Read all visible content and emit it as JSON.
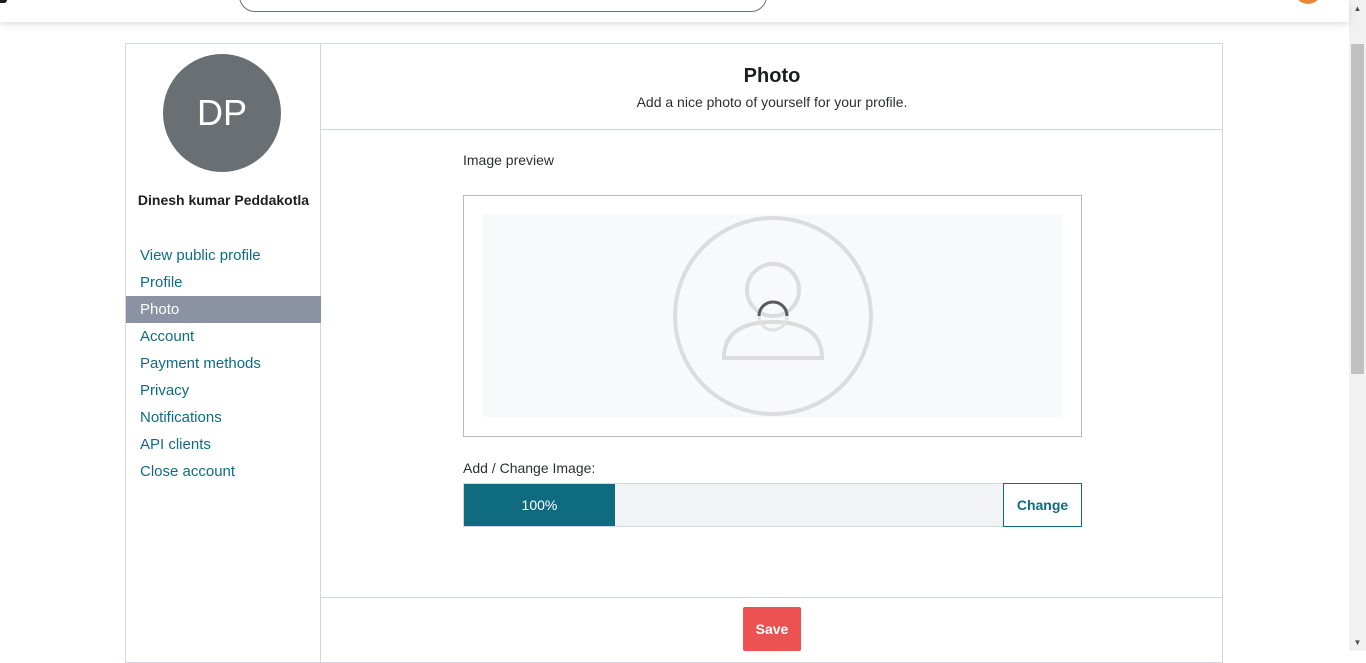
{
  "user": {
    "initials": "DP",
    "name": "Dinesh kumar Peddakotla"
  },
  "sidebar": {
    "items": [
      {
        "label": "View public profile",
        "active": false
      },
      {
        "label": "Profile",
        "active": false
      },
      {
        "label": "Photo",
        "active": true
      },
      {
        "label": "Account",
        "active": false
      },
      {
        "label": "Payment methods",
        "active": false
      },
      {
        "label": "Privacy",
        "active": false
      },
      {
        "label": "Notifications",
        "active": false
      },
      {
        "label": "API clients",
        "active": false
      },
      {
        "label": "Close account",
        "active": false
      }
    ]
  },
  "main": {
    "title": "Photo",
    "subtitle": "Add a nice photo of yourself for your profile.",
    "preview_label": "Image preview",
    "change_label": "Add / Change Image:",
    "progress": {
      "value": 28,
      "label": "100%"
    },
    "change_button": "Change",
    "save_button": "Save"
  },
  "colors": {
    "accent": "#0f6c80",
    "save": "#ec5252",
    "active_nav": "#8a92a3",
    "avatar_bg": "#6a6f73"
  },
  "icons": [
    "user-placeholder-icon",
    "loading-spinner-icon",
    "scroll-up-arrow-icon",
    "scroll-down-arrow-icon"
  ]
}
